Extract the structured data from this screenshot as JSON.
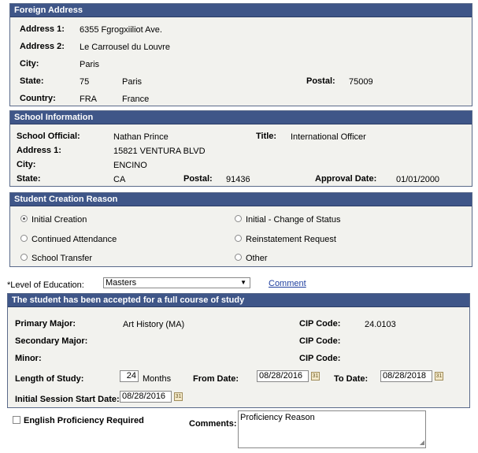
{
  "foreign": {
    "title": "Foreign Address",
    "address1_label": "Address 1:",
    "address1": "6355 Fgrogxiiliot Ave.",
    "address2_label": "Address 2:",
    "address2": "Le Carrousel du Louvre",
    "city_label": "City:",
    "city": "Paris",
    "state_label": "State:",
    "state_code": "75",
    "state_name": "Paris",
    "postal_label": "Postal:",
    "postal": "75009",
    "country_label": "Country:",
    "country_code": "FRA",
    "country_name": "France"
  },
  "school": {
    "title": "School Information",
    "official_label": "School Official:",
    "official": "Nathan Prince",
    "title_label": "Title:",
    "official_title": "International Officer",
    "address1_label": "Address 1:",
    "address1": "15821 VENTURA BLVD",
    "city_label": "City:",
    "city": "ENCINO",
    "state_label": "State:",
    "state": "CA",
    "postal_label": "Postal:",
    "postal": "91436",
    "approval_label": "Approval Date:",
    "approval_date": "01/01/2000"
  },
  "reason": {
    "title": "Student Creation Reason",
    "options": [
      "Initial Creation",
      "Initial - Change of Status",
      "Continued Attendance",
      "Reinstatement Request",
      "School Transfer",
      "Other"
    ],
    "selected": "Initial Creation"
  },
  "level": {
    "label": "*Level of Education:",
    "value": "Masters",
    "comment_link": "Comment"
  },
  "study": {
    "title": "The student has been accepted for a full course of study",
    "primary_label": "Primary Major:",
    "primary": "Art History (MA)",
    "cip_label": "CIP Code:",
    "primary_cip": "24.0103",
    "secondary_label": "Secondary Major:",
    "minor_label": "Minor:",
    "length_label": "Length of Study:",
    "length": "24",
    "months": "Months",
    "from_label": "From Date:",
    "from_date": "08/28/2016",
    "to_label": "To Date:",
    "to_date": "08/28/2018",
    "session_label": "Initial Session Start Date:",
    "session_date": "08/28/2016"
  },
  "english": {
    "checkbox_label": "English Proficiency Required",
    "comments_label": "Comments:",
    "comments_value": "Proficiency Reason"
  }
}
